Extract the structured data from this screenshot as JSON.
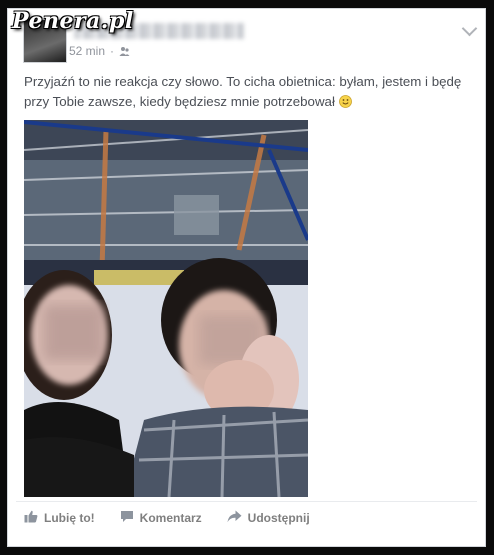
{
  "watermark": "Penera.pl",
  "post": {
    "time": "52 min",
    "privacy_icon": "friends-icon",
    "text": "Przyjaźń to nie reakcja czy słowo. To cicha obietnica: byłam, jestem i będę przy Tobie zawsze, kiedy będziesz mnie potrzebował"
  },
  "actions": {
    "like": "Lubię to!",
    "comment": "Komentarz",
    "share": "Udostępnij"
  },
  "colors": {
    "text": "#4b4f56",
    "meta": "#90949c",
    "action": "#7f7f7f"
  }
}
